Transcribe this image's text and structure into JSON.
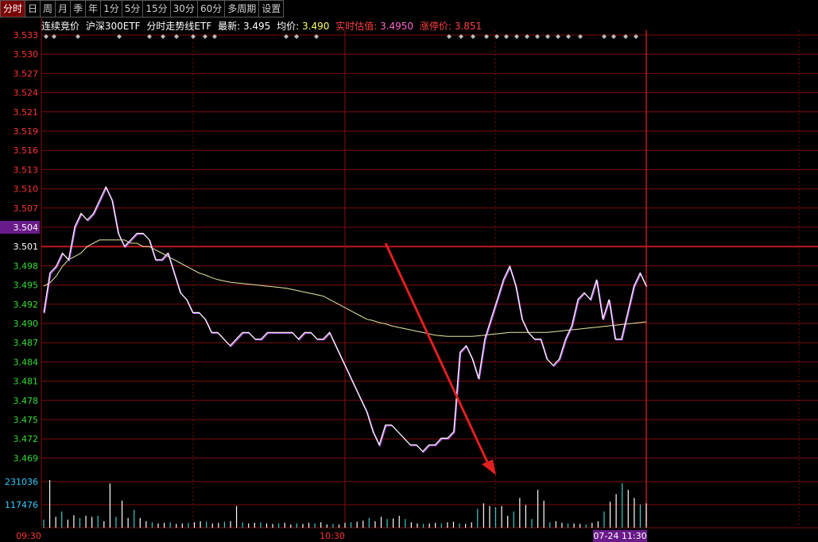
{
  "toolbar": {
    "tabs": [
      "分时",
      "日",
      "周",
      "月",
      "季",
      "年",
      "1分",
      "5分",
      "15分",
      "30分",
      "60分",
      "多周期",
      "设置"
    ],
    "active": 0
  },
  "infobar": {
    "auction": "连续竞价",
    "name": "沪深300ETF",
    "chart_title": "分时走势线ETF",
    "latest_label": "最新:",
    "latest_value": "3.495",
    "avg_label": "均价:",
    "avg_value": "3.490",
    "est_label": "实时估值:",
    "est_value": "3.4950",
    "limit_label": "涨停价:",
    "limit_value": "3.851"
  },
  "chart_data": {
    "type": "line",
    "price_ticks": [
      "3.533",
      "3.530",
      "3.527",
      "3.524",
      "3.521",
      "3.519",
      "3.516",
      "3.513",
      "3.510",
      "3.507",
      "3.504",
      "3.501",
      "3.498",
      "3.495",
      "3.492",
      "3.490",
      "3.487",
      "3.484",
      "3.481",
      "3.478",
      "3.475",
      "3.472",
      "3.469"
    ],
    "highlight_tick": "3.504",
    "ylim": [
      3.469,
      3.533
    ],
    "volume_ticks": [
      "231036",
      "117476"
    ],
    "time_labels": [
      "09:30",
      "10:30"
    ],
    "cursor_label": "07-24 11:30",
    "price": [
      3.491,
      3.497,
      3.498,
      3.5,
      3.499,
      3.504,
      3.506,
      3.505,
      3.506,
      3.508,
      3.51,
      3.508,
      3.503,
      3.501,
      3.502,
      3.503,
      3.503,
      3.502,
      3.499,
      3.499,
      3.5,
      3.497,
      3.494,
      3.493,
      3.491,
      3.491,
      3.49,
      3.488,
      3.488,
      3.487,
      3.486,
      3.487,
      3.488,
      3.488,
      3.487,
      3.487,
      3.488,
      3.488,
      3.488,
      3.488,
      3.488,
      3.487,
      3.488,
      3.488,
      3.487,
      3.487,
      3.488,
      3.486,
      3.484,
      3.482,
      3.48,
      3.478,
      3.476,
      3.473,
      3.471,
      3.474,
      3.474,
      3.473,
      3.472,
      3.471,
      3.471,
      3.47,
      3.471,
      3.471,
      3.472,
      3.472,
      3.473,
      3.485,
      3.486,
      3.484,
      3.481,
      3.487,
      3.49,
      3.493,
      3.496,
      3.498,
      3.495,
      3.49,
      3.488,
      3.487,
      3.487,
      3.484,
      3.483,
      3.484,
      3.487,
      3.489,
      3.493,
      3.494,
      3.493,
      3.496,
      3.49,
      3.493,
      3.487,
      3.487,
      3.491,
      3.495,
      3.497,
      3.495
    ],
    "avg": [
      3.495,
      3.4955,
      3.4965,
      3.498,
      3.499,
      3.4995,
      3.5,
      3.501,
      3.5015,
      3.502,
      3.502,
      3.502,
      3.502,
      3.502,
      3.5015,
      3.5015,
      3.501,
      3.501,
      3.5005,
      3.5,
      3.4995,
      3.499,
      3.4985,
      3.498,
      3.4975,
      3.497,
      3.4967,
      3.4963,
      3.496,
      3.4958,
      3.4956,
      3.4955,
      3.4954,
      3.4953,
      3.4952,
      3.4951,
      3.495,
      3.4949,
      3.4948,
      3.4947,
      3.4945,
      3.4943,
      3.4941,
      3.4939,
      3.4937,
      3.4935,
      3.493,
      3.4925,
      3.492,
      3.4915,
      3.491,
      3.4905,
      3.49,
      3.4898,
      3.4895,
      3.4893,
      3.489,
      3.4888,
      3.4886,
      3.4884,
      3.4882,
      3.488,
      3.4878,
      3.4876,
      3.4875,
      3.4874,
      3.4874,
      3.4874,
      3.4874,
      3.4874,
      3.4875,
      3.4876,
      3.4877,
      3.4878,
      3.4879,
      3.488,
      3.488,
      3.488,
      3.488,
      3.488,
      3.488,
      3.488,
      3.4881,
      3.4882,
      3.4883,
      3.4884,
      3.4885,
      3.4886,
      3.4887,
      3.4888,
      3.4889,
      3.489,
      3.4891,
      3.4892,
      3.4893,
      3.4894,
      3.4895,
      3.4896
    ],
    "volume": [
      15000,
      88000,
      20000,
      30000,
      15000,
      23000,
      18000,
      22000,
      20000,
      22000,
      12000,
      82000,
      20000,
      50000,
      18000,
      33000,
      18000,
      12000,
      10000,
      8000,
      9000,
      10000,
      7000,
      8000,
      9000,
      10000,
      12000,
      11000,
      8000,
      9000,
      11000,
      12000,
      40000,
      10000,
      8000,
      9000,
      10000,
      8000,
      7000,
      8000,
      9000,
      6000,
      8000,
      7000,
      9000,
      8000,
      10000,
      6000,
      7000,
      6000,
      9000,
      10000,
      11000,
      13000,
      18000,
      12000,
      20000,
      16000,
      17000,
      22000,
      16000,
      10000,
      8000,
      7000,
      8000,
      9000,
      8000,
      10000,
      11000,
      8000,
      7000,
      10000,
      35000,
      45000,
      40000,
      38000,
      40000,
      22000,
      30000,
      55000,
      42000,
      16000,
      70000,
      50000,
      10000,
      12000,
      9000,
      8000,
      8000,
      7000,
      6000,
      9000,
      12000,
      30000,
      48000,
      62000,
      82000,
      70000,
      55000,
      43000,
      45000
    ]
  }
}
